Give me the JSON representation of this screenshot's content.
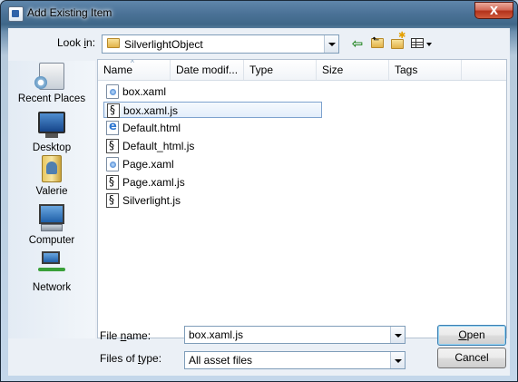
{
  "window": {
    "title": "Add Existing Item",
    "close_label": "X"
  },
  "toolbar": {
    "look_in_label_pre": "Look ",
    "look_in_label_ul": "i",
    "look_in_label_post": "n:",
    "look_in_value": "SilverlightObject",
    "back_icon": "back-arrow-icon",
    "up_icon": "up-one-level-icon",
    "new_folder_icon": "new-folder-icon",
    "views_icon": "views-menu-icon"
  },
  "places": [
    {
      "label": "Recent Places",
      "icon": "recent-places-icon"
    },
    {
      "label": "Desktop",
      "icon": "desktop-icon"
    },
    {
      "label": "Valerie",
      "icon": "user-folder-icon"
    },
    {
      "label": "Computer",
      "icon": "computer-icon"
    },
    {
      "label": "Network",
      "icon": "network-icon"
    }
  ],
  "columns": [
    "Name",
    "Date modif...",
    "Type",
    "Size",
    "Tags"
  ],
  "files": [
    {
      "name": "box.xaml",
      "kind": "xaml"
    },
    {
      "name": "box.xaml.js",
      "kind": "js",
      "selected": true
    },
    {
      "name": "Default.html",
      "kind": "html"
    },
    {
      "name": "Default_html.js",
      "kind": "js"
    },
    {
      "name": "Page.xaml",
      "kind": "xaml"
    },
    {
      "name": "Page.xaml.js",
      "kind": "js"
    },
    {
      "name": "Silverlight.js",
      "kind": "js"
    }
  ],
  "file_name": {
    "label_pre": "File ",
    "label_ul": "n",
    "label_post": "ame:",
    "value": "box.xaml.js"
  },
  "file_type": {
    "label_pre": "Files of ",
    "label_ul": "t",
    "label_post": "ype:",
    "value": "All asset files"
  },
  "buttons": {
    "open_ul": "O",
    "open_rest": "pen",
    "cancel": "Cancel"
  }
}
